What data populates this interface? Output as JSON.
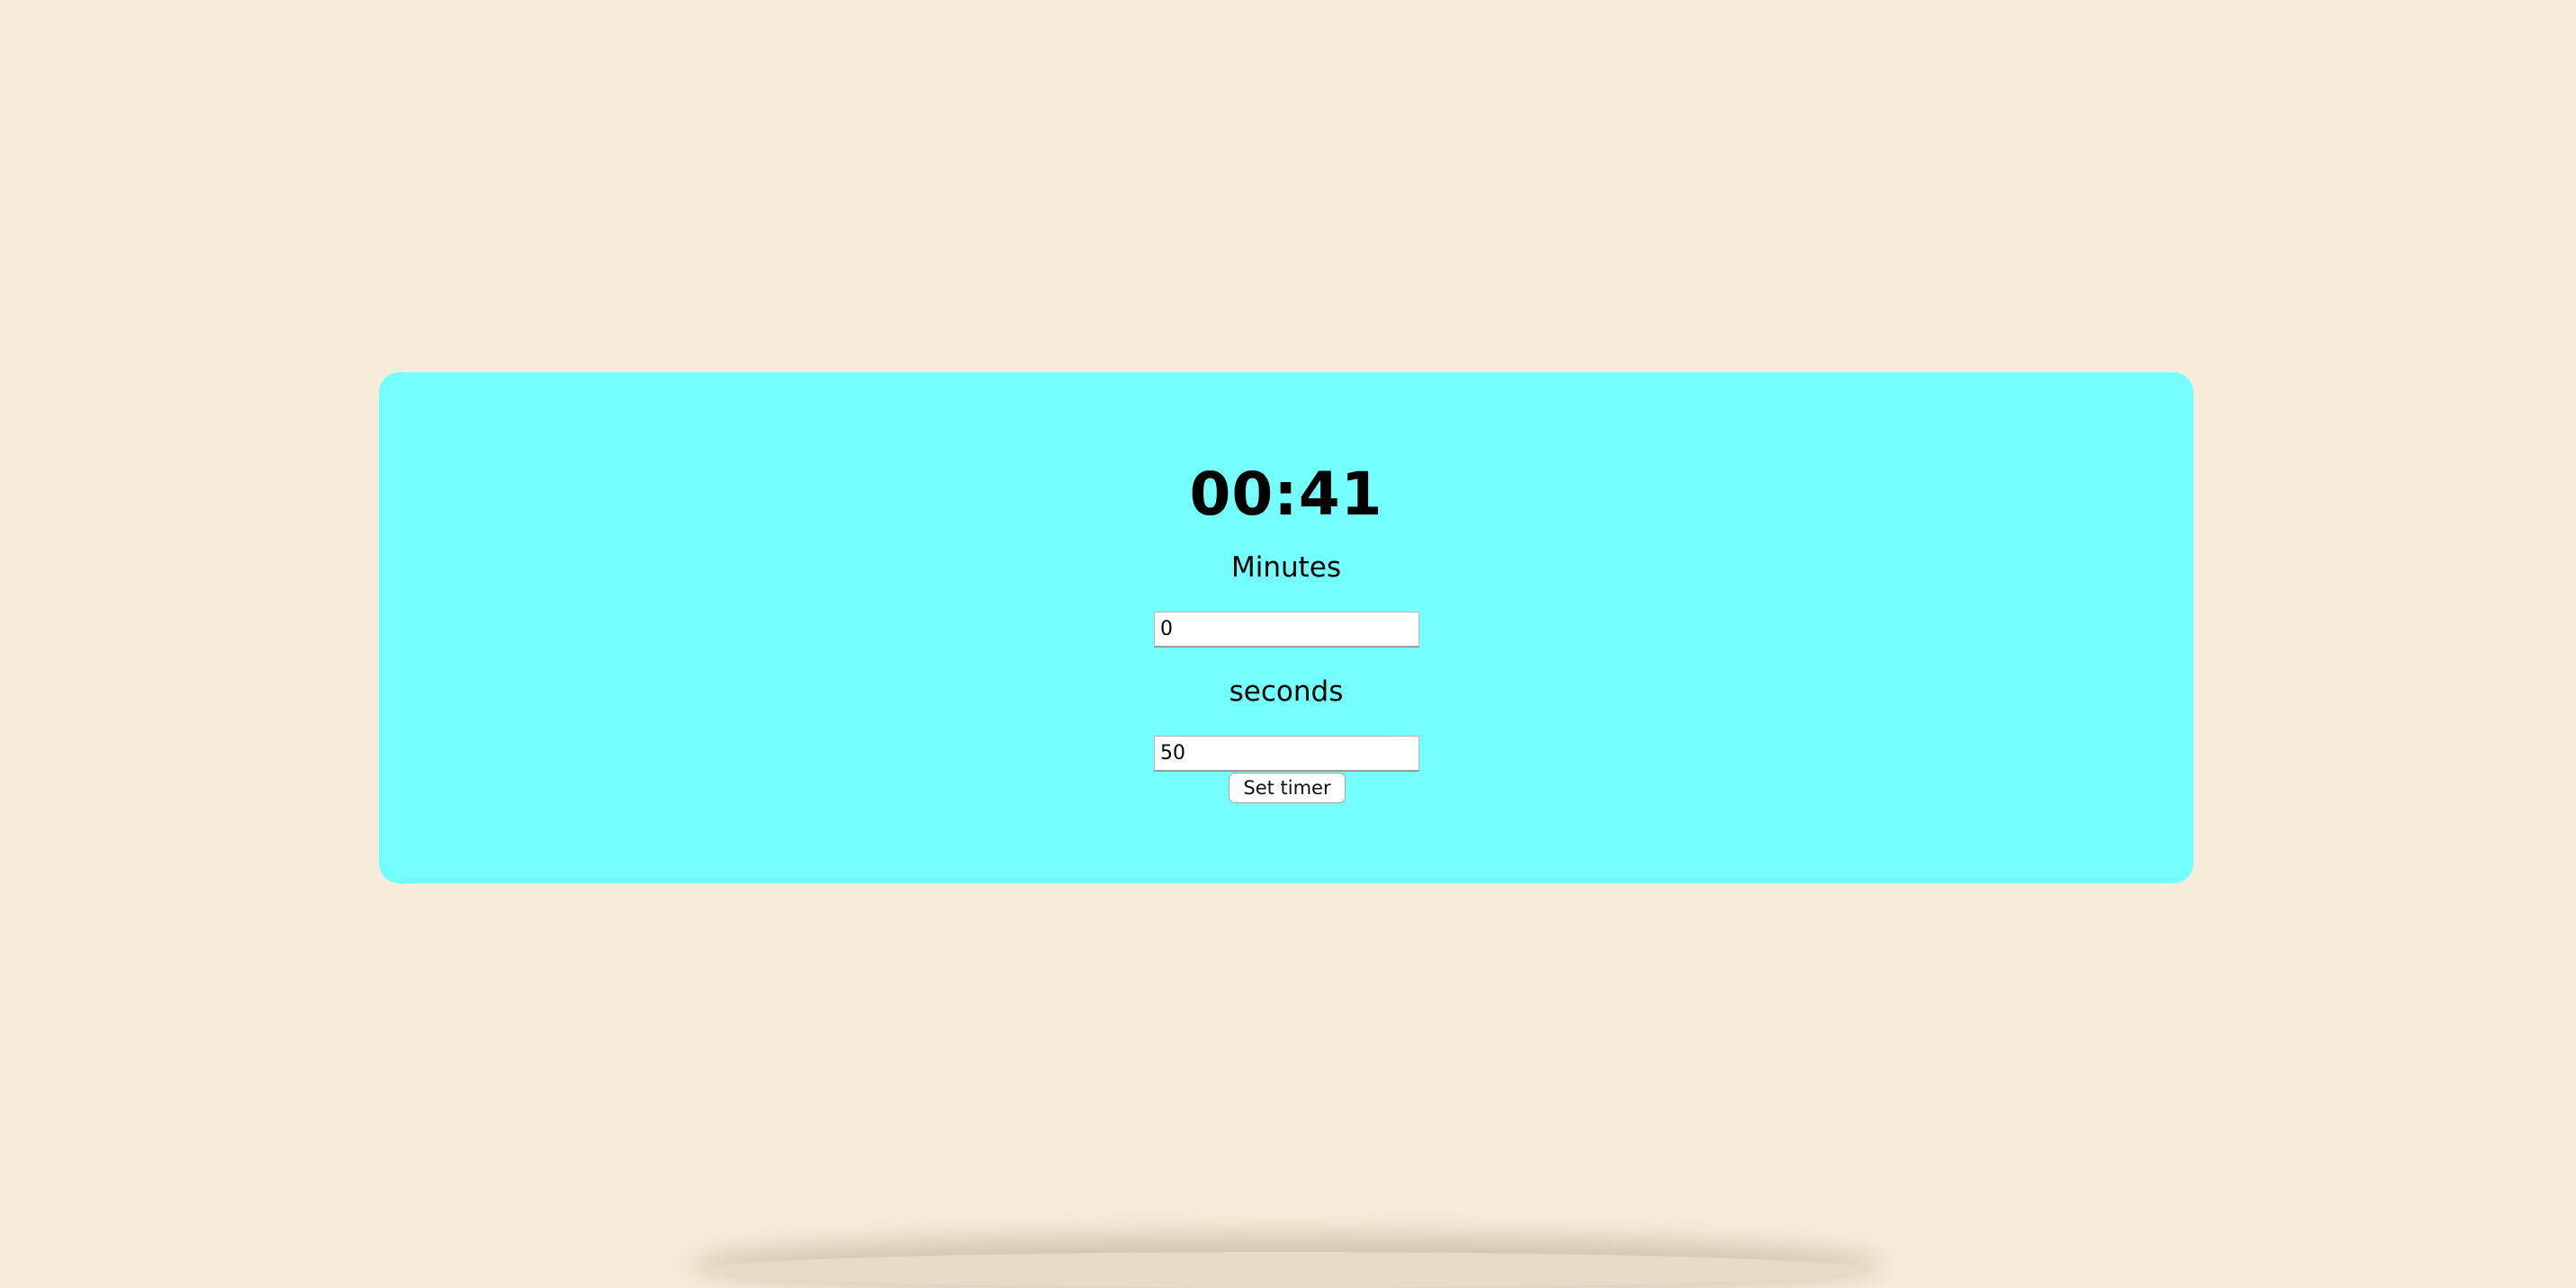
{
  "timer": {
    "display": "00:41"
  },
  "minutes": {
    "label": "Minutes",
    "value": "0"
  },
  "seconds": {
    "label": "seconds",
    "value": "50"
  },
  "set_button": {
    "label": "Set timer"
  },
  "colors": {
    "page_background": "#f7ecda",
    "card_background": "#75fefe"
  }
}
